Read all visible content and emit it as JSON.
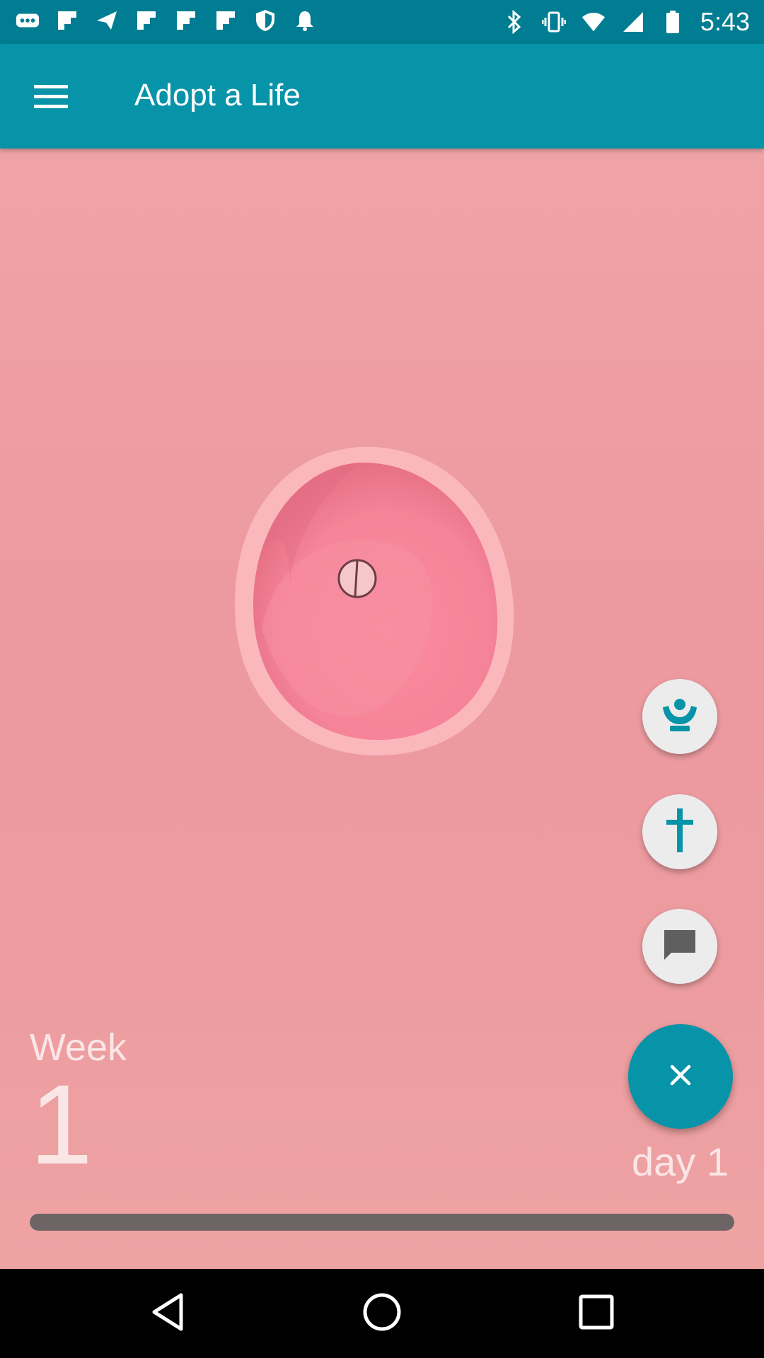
{
  "status_bar": {
    "time": "5:43",
    "left_icons": [
      "more-dots-icon",
      "flipboard-icon",
      "send-icon",
      "flipboard-icon",
      "flipboard-icon",
      "flipboard-icon",
      "shield-icon",
      "bell-icon"
    ],
    "right_icons": [
      "bluetooth-icon",
      "vibrate-icon",
      "wifi-icon",
      "signal-icon",
      "battery-icon"
    ]
  },
  "app_bar": {
    "title": "Adopt a Life",
    "background": "#0793a8"
  },
  "actions": {
    "prayer": "prayer-icon",
    "cross": "cross-icon",
    "chat": "chat-icon",
    "close": "close-icon"
  },
  "progress": {
    "week_label": "Week",
    "week_number": "1",
    "day_label": "day 1",
    "fraction": 1.0
  },
  "colors": {
    "accent": "#0793a8",
    "content_bg": "#ec9aa0",
    "text_light": "#fbe6e6"
  }
}
